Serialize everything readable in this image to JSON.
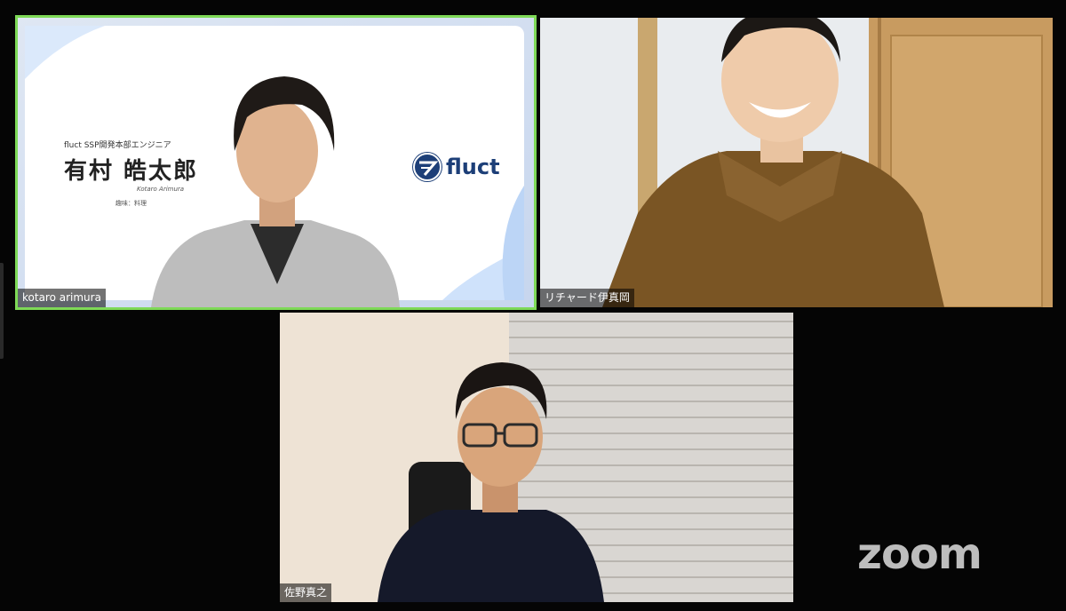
{
  "app": {
    "logo": "zoom"
  },
  "participants": [
    {
      "name": "kotaro arimura",
      "active_speaker": true,
      "virtual_background": {
        "role": "fluct SSP開発本部エンジニア",
        "name_jp": "有村 皓太郎",
        "name_roman": "Kotaro Arimura",
        "hobby": "趣味：料理",
        "brand": "fluct"
      }
    },
    {
      "name": "リチャード伊真岡",
      "active_speaker": false
    },
    {
      "name": "佐野真之",
      "active_speaker": false
    }
  ],
  "colors": {
    "active_speaker_ring": "#7ed957",
    "brand_navy": "#1d3f78"
  }
}
